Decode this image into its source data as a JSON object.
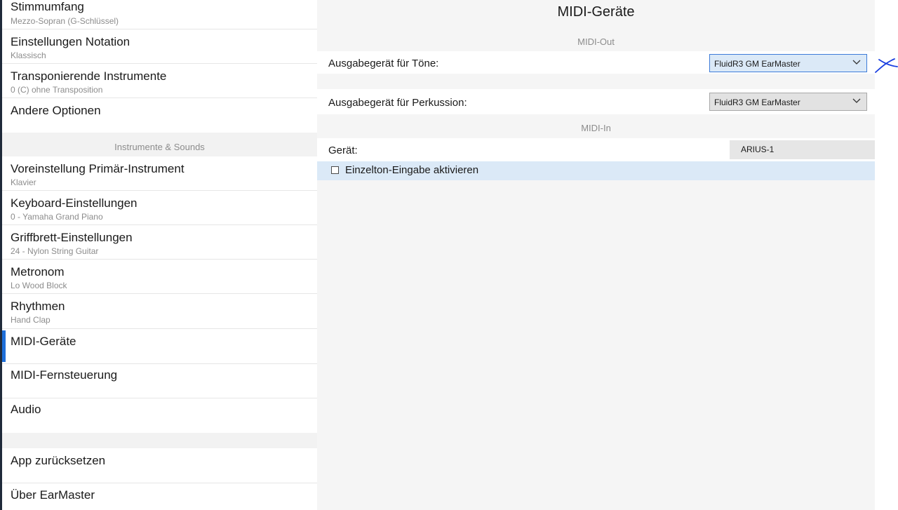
{
  "sidebar": {
    "items": [
      {
        "title": "Stimmumfang",
        "subtitle": "Mezzo-Sopran (G-Schlüssel)"
      },
      {
        "title": "Einstellungen Notation",
        "subtitle": "Klassisch"
      },
      {
        "title": "Transponierende Instrumente",
        "subtitle": "0 (C) ohne Transposition"
      },
      {
        "title": "Andere Optionen",
        "subtitle": ""
      }
    ],
    "section_label": "Instrumente & Sounds",
    "sound_items": [
      {
        "title": "Voreinstellung Primär-Instrument",
        "subtitle": "Klavier"
      },
      {
        "title": "Keyboard-Einstellungen",
        "subtitle": "0 - Yamaha Grand Piano"
      },
      {
        "title": "Griffbrett-Einstellungen",
        "subtitle": "24 - Nylon String Guitar"
      },
      {
        "title": "Metronom",
        "subtitle": "Lo Wood Block"
      },
      {
        "title": "Rhythmen",
        "subtitle": "Hand Clap"
      },
      {
        "title": "MIDI-Geräte",
        "subtitle": ""
      },
      {
        "title": "MIDI-Fernsteuerung",
        "subtitle": ""
      },
      {
        "title": "Audio",
        "subtitle": ""
      }
    ],
    "bottom_items": [
      {
        "title": "App zurücksetzen"
      },
      {
        "title": "Über EarMaster"
      }
    ]
  },
  "main": {
    "title": "MIDI-Geräte",
    "midi_out_label": "MIDI-Out",
    "tone_output_label": "Ausgabegerät für Töne:",
    "tone_output_value": "FluidR3 GM EarMaster",
    "percussion_output_label": "Ausgabegerät für Perkussion:",
    "percussion_output_value": "FluidR3 GM EarMaster",
    "midi_in_label": "MIDI-In",
    "device_label": "Gerät:",
    "device_value": "ARIUS-1",
    "single_note_label": "Einzelton-Eingabe aktivieren",
    "single_note_checked": false
  },
  "colors": {
    "accent": "#1e6fd9",
    "focused_select_bg": "#dbe9f7",
    "annotation": "#1a3fe0"
  }
}
